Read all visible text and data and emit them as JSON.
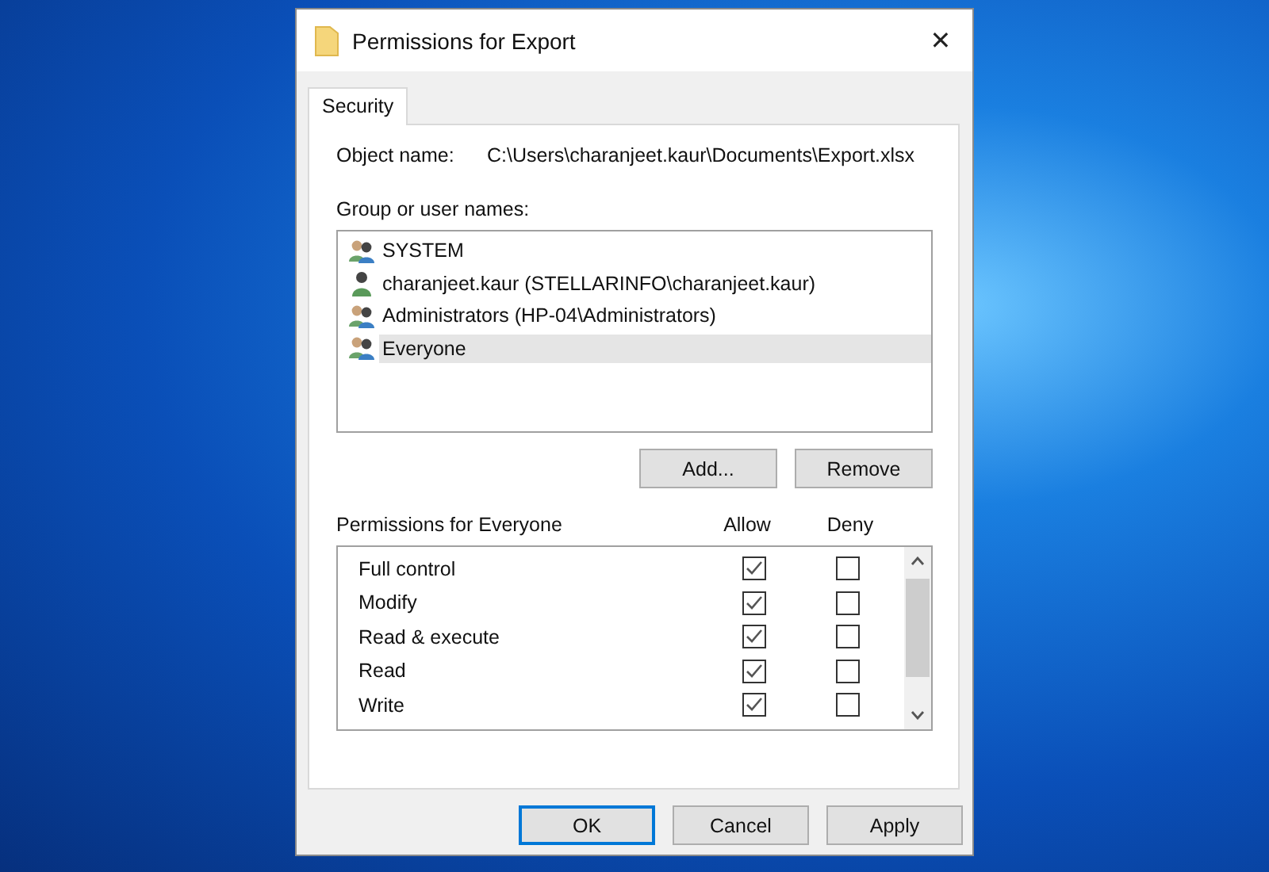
{
  "window": {
    "title": "Permissions for Export",
    "close": "✕"
  },
  "tabs": [
    {
      "label": "Security",
      "selected": true
    }
  ],
  "object_name": {
    "label": "Object name:",
    "value": "C:\\Users\\charanjeet.kaur\\Documents\\Export.xlsx"
  },
  "users": {
    "label": "Group or user names:",
    "items": [
      {
        "name": "SYSTEM",
        "kind": "group",
        "selected": false
      },
      {
        "name": "charanjeet.kaur (STELLARINFO\\charanjeet.kaur)",
        "kind": "user",
        "selected": false
      },
      {
        "name": "Administrators (HP-04\\Administrators)",
        "kind": "group",
        "selected": false
      },
      {
        "name": "Everyone",
        "kind": "group",
        "selected": true
      }
    ],
    "buttons": [
      "Add...",
      "Remove"
    ]
  },
  "permissions": {
    "label": "Permissions for Everyone",
    "allow_label": "Allow",
    "deny_label": "Deny",
    "rows": [
      {
        "name": "Full control",
        "allow": true,
        "deny": false
      },
      {
        "name": "Modify",
        "allow": true,
        "deny": false
      },
      {
        "name": "Read & execute",
        "allow": true,
        "deny": false
      },
      {
        "name": "Read",
        "allow": true,
        "deny": false
      },
      {
        "name": "Write",
        "allow": true,
        "deny": false
      }
    ]
  },
  "buttons": [
    {
      "label": "OK",
      "default": true
    },
    {
      "label": "Cancel",
      "default": false
    },
    {
      "label": "Apply",
      "default": false
    }
  ]
}
